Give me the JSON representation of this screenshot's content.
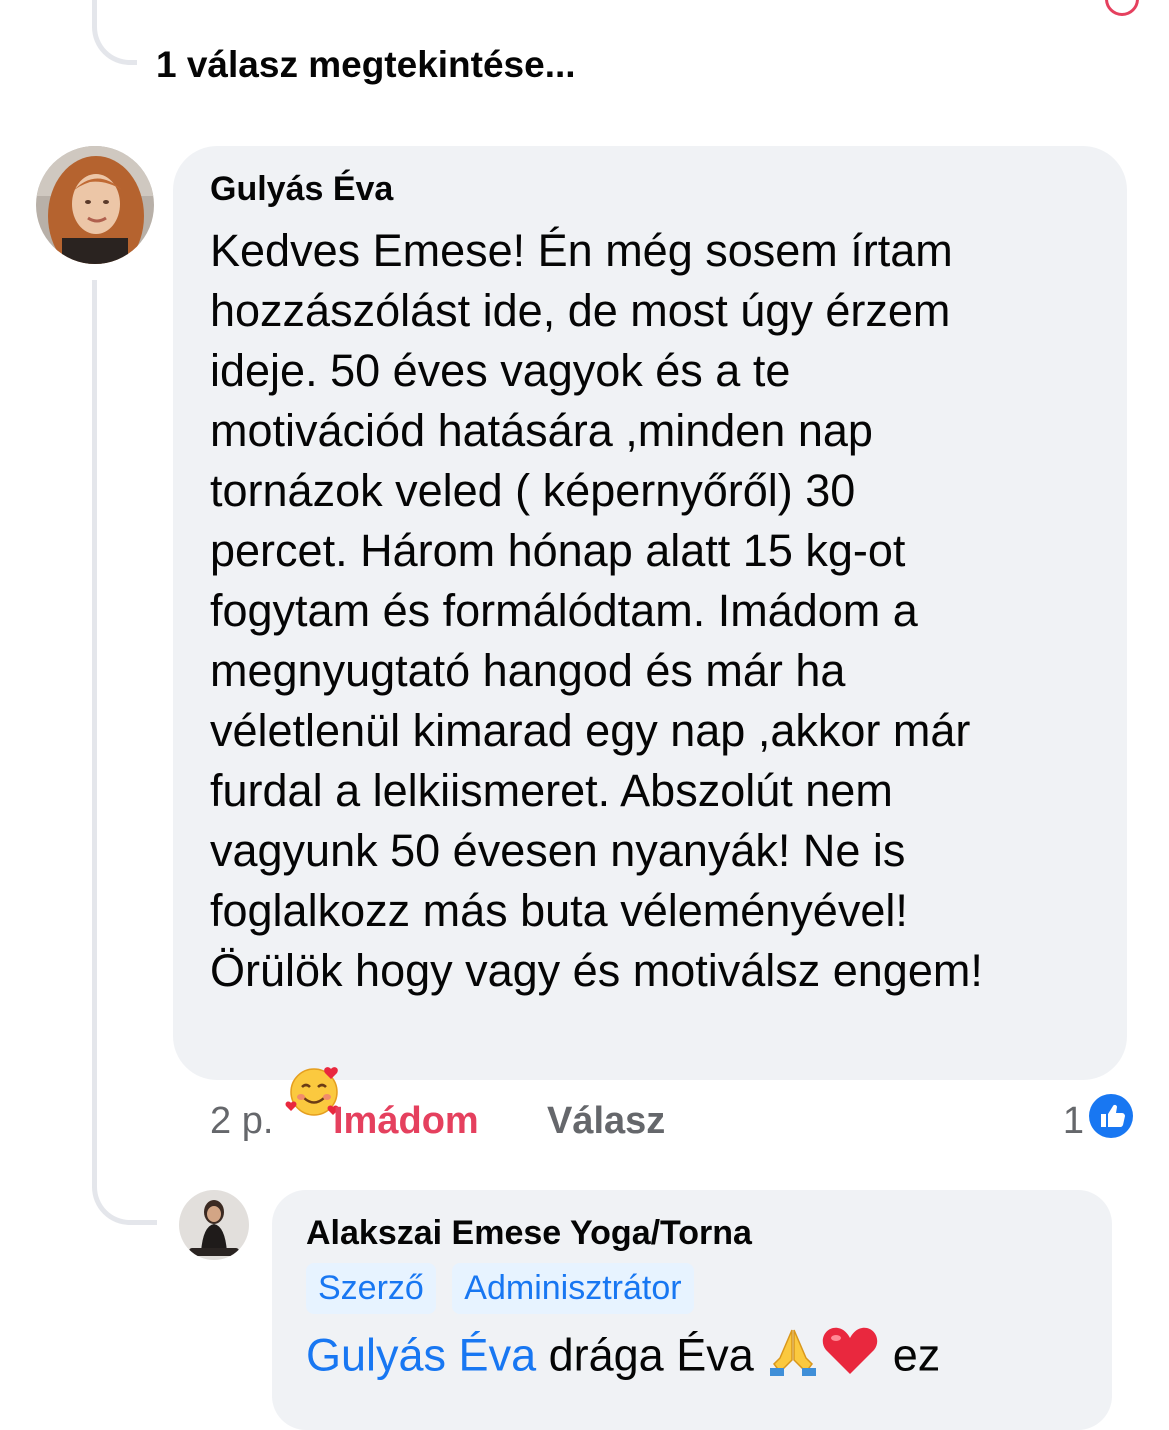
{
  "thread": {
    "view_replies_label": "1 válasz megtekintése..."
  },
  "comment": {
    "author": "Gulyás Éva",
    "text": "Kedves Emese! Én még sosem írtam\nhozzászólást ide, de most úgy érzem\nideje. 50 éves vagyok és a te\nmotivációd hatására ,minden nap\ntornázok veled ( képernyőről) 30\npercet. Három hónap alatt 15 kg-ot\nfogytam és formálódtam. Imádom a\nmegnyugtató hangod és már ha\nvéletlenül kimarad egy nap ,akkor már\nfurdal a lelkiismeret. Abszolút nem\nvagyunk 50 évesen nyanyák! Ne is\nfoglalkozz más buta véleményével!\nÖrülök hogy vagy és motiválsz engem!",
    "emoji": "smiling-face-with-hearts",
    "time": "2 p.",
    "reacted_label": "Imádom",
    "reply_label": "Válasz",
    "reaction_count": "1",
    "reaction_icon": "like-icon",
    "colors": {
      "reacted": "#e5405e",
      "like_blue": "#1877f2"
    }
  },
  "reply": {
    "author": "Alakszai Emese Yoga/Torna",
    "badges": [
      "Szerző",
      "Adminisztrátor"
    ],
    "mention": "Gulyás Éva",
    "text_start": " drága Éva ",
    "text_end": " ez",
    "emojis": [
      "folded-hands",
      "red-heart"
    ]
  }
}
